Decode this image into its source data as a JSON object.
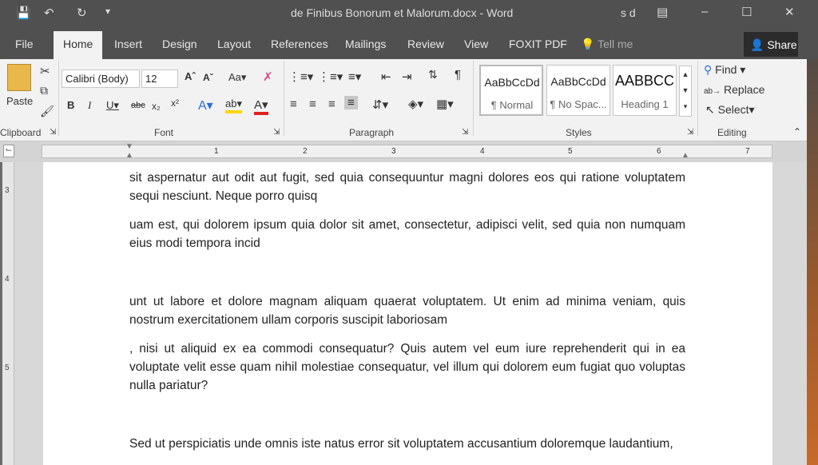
{
  "window": {
    "title": "de Finibus Bonorum et Malorum.docx - Word",
    "user": "s d"
  },
  "tabs": [
    "File",
    "Home",
    "Insert",
    "Design",
    "Layout",
    "References",
    "Mailings",
    "Review",
    "View",
    "FOXIT PDF"
  ],
  "tell_me": "Tell me",
  "share": "Share",
  "clipboard": {
    "paste": "Paste",
    "label": "Clipboard"
  },
  "font": {
    "name": "Calibri (Body)",
    "size": "12",
    "label": "Font",
    "case": "Aa"
  },
  "paragraph": {
    "label": "Paragraph"
  },
  "styles": {
    "label": "Styles",
    "items": [
      {
        "preview": "AaBbCcDd",
        "name": "¶ Normal"
      },
      {
        "preview": "AaBbCcDd",
        "name": "¶ No Spac..."
      },
      {
        "preview": "AABBCC",
        "name": "Heading 1"
      }
    ]
  },
  "editing": {
    "find": "Find",
    "replace": "Replace",
    "select": "Select",
    "label": "Editing"
  },
  "ruler": {
    "numbers": [
      "1",
      "2",
      "3",
      "4",
      "5",
      "6",
      "7"
    ],
    "vnumbers": [
      "3",
      "4",
      "5"
    ]
  },
  "document": {
    "paragraphs": [
      "sit aspernatur aut odit aut fugit, sed quia consequuntur magni dolores eos qui ratione voluptatem sequi nesciunt. Neque porro quisq",
      "uam est, qui dolorem ipsum quia dolor sit amet, consectetur, adipisci velit, sed quia non numquam eius modi tempora incid",
      "unt ut labore et dolore magnam aliquam quaerat voluptatem. Ut enim ad minima veniam, quis nostrum exercitationem ullam corporis suscipit laboriosam",
      ", nisi ut aliquid ex ea commodi consequatur? Quis autem vel eum iure reprehenderit qui in ea voluptate velit esse quam nihil molestiae consequatur, vel illum qui dolorem eum fugiat quo voluptas nulla pariatur?",
      "Sed ut perspiciatis unde omnis iste natus error sit voluptatem accusantium doloremque laudantium,"
    ]
  }
}
